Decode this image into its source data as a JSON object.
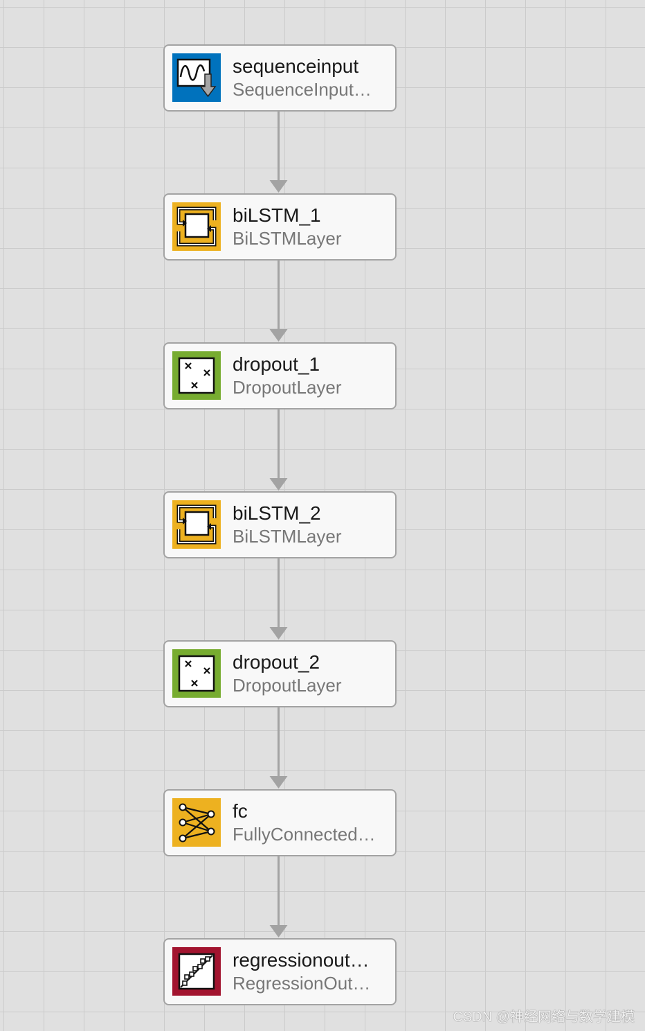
{
  "diagram": {
    "layers": [
      {
        "name": "sequenceinput",
        "type": "SequenceInput…",
        "icon": "sequence-input-icon",
        "color": "#0072BD"
      },
      {
        "name": "biLSTM_1",
        "type": "BiLSTMLayer",
        "icon": "bilstm-icon",
        "color": "#EDB120"
      },
      {
        "name": "dropout_1",
        "type": "DropoutLayer",
        "icon": "dropout-icon",
        "color": "#77AC30"
      },
      {
        "name": "biLSTM_2",
        "type": "BiLSTMLayer",
        "icon": "bilstm-icon",
        "color": "#EDB120"
      },
      {
        "name": "dropout_2",
        "type": "DropoutLayer",
        "icon": "dropout-icon",
        "color": "#77AC30"
      },
      {
        "name": "fc",
        "type": "FullyConnected…",
        "icon": "fully-connected-icon",
        "color": "#EDB120"
      },
      {
        "name": "regressionout…",
        "type": "RegressionOut…",
        "icon": "regression-output-icon",
        "color": "#A2142F"
      }
    ],
    "edges": [
      {
        "from": 0,
        "to": 1
      },
      {
        "from": 1,
        "to": 2
      },
      {
        "from": 2,
        "to": 3
      },
      {
        "from": 3,
        "to": 4
      },
      {
        "from": 4,
        "to": 5
      },
      {
        "from": 5,
        "to": 6
      }
    ],
    "edge_color": "#A3A3A3"
  },
  "watermark": "CSDN @神经网络与数学建模"
}
